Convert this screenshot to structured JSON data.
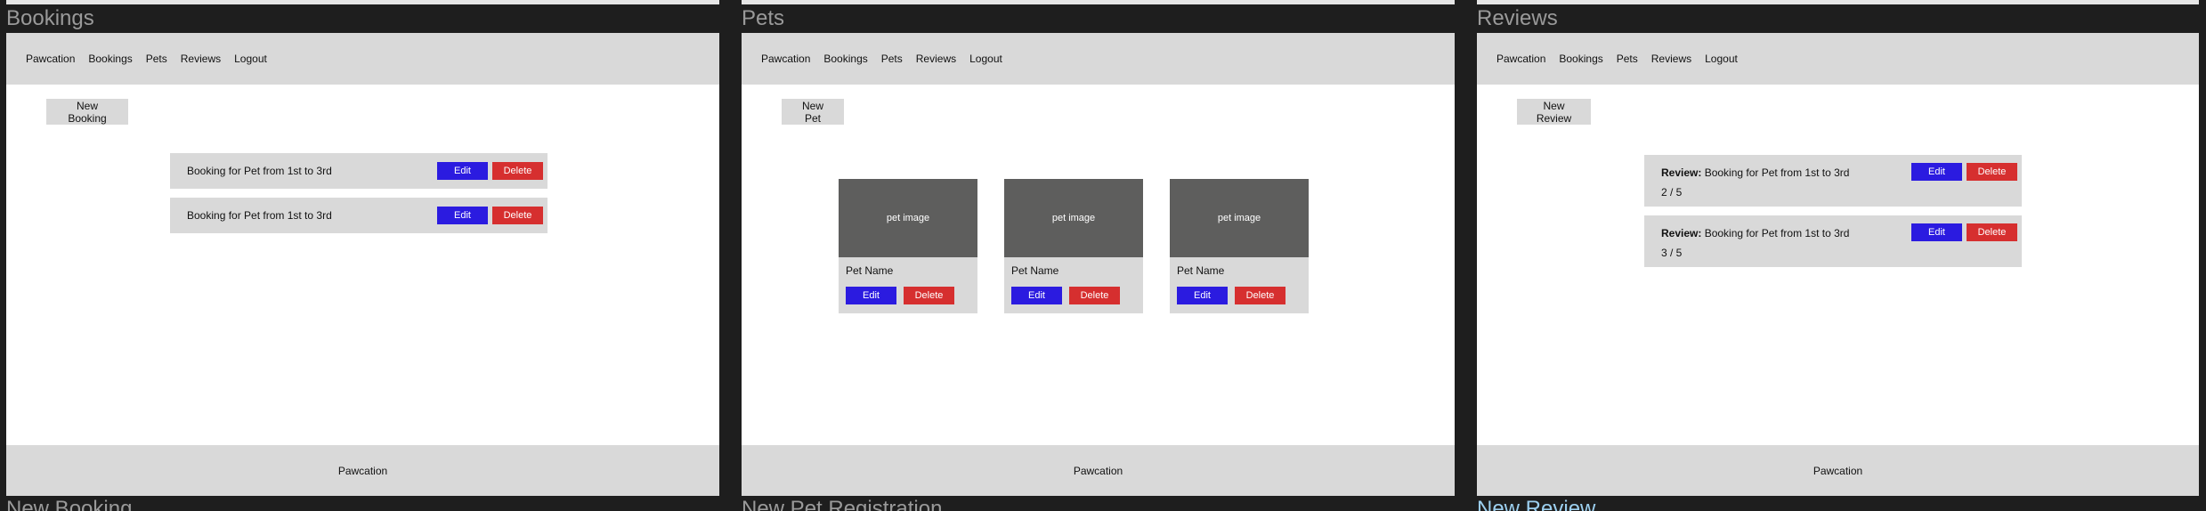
{
  "frames": [
    {
      "title": "Bookings",
      "bottom_title": "New Booking",
      "nav": [
        "Pawcation",
        "Bookings",
        "Pets",
        "Reviews",
        "Logout"
      ],
      "new_button": "New Booking",
      "items": [
        {
          "label": "Booking for Pet from 1st to 3rd",
          "edit": "Edit",
          "delete": "Delete"
        },
        {
          "label": "Booking for Pet from 1st to 3rd",
          "edit": "Edit",
          "delete": "Delete"
        }
      ],
      "footer": "Pawcation"
    },
    {
      "title": "Pets",
      "bottom_title": "New Pet Registration",
      "nav": [
        "Pawcation",
        "Bookings",
        "Pets",
        "Reviews",
        "Logout"
      ],
      "new_button": "New Pet",
      "items": [
        {
          "image_label": "pet image",
          "name": "Pet Name",
          "edit": "Edit",
          "delete": "Delete"
        },
        {
          "image_label": "pet image",
          "name": "Pet Name",
          "edit": "Edit",
          "delete": "Delete"
        },
        {
          "image_label": "pet image",
          "name": "Pet Name",
          "edit": "Edit",
          "delete": "Delete"
        }
      ],
      "footer": "Pawcation"
    },
    {
      "title": "Reviews",
      "bottom_title": "New Review",
      "nav": [
        "Pawcation",
        "Bookings",
        "Pets",
        "Reviews",
        "Logout"
      ],
      "new_button": "New Review",
      "items": [
        {
          "prefix": "Review:",
          "label": "Booking for Pet from 1st to 3rd",
          "rating": "2 / 5",
          "edit": "Edit",
          "delete": "Delete"
        },
        {
          "prefix": "Review:",
          "label": "Booking for Pet from 1st to 3rd",
          "rating": "3 / 5",
          "edit": "Edit",
          "delete": "Delete"
        }
      ],
      "footer": "Pawcation"
    }
  ],
  "colors": {
    "edit": "#2b1be0",
    "delete": "#d62f2f",
    "bar": "#d9d9d9",
    "pet_image": "#5e5e5d",
    "canvas": "#1e1e1e",
    "accent_title": "#9ccfef"
  }
}
